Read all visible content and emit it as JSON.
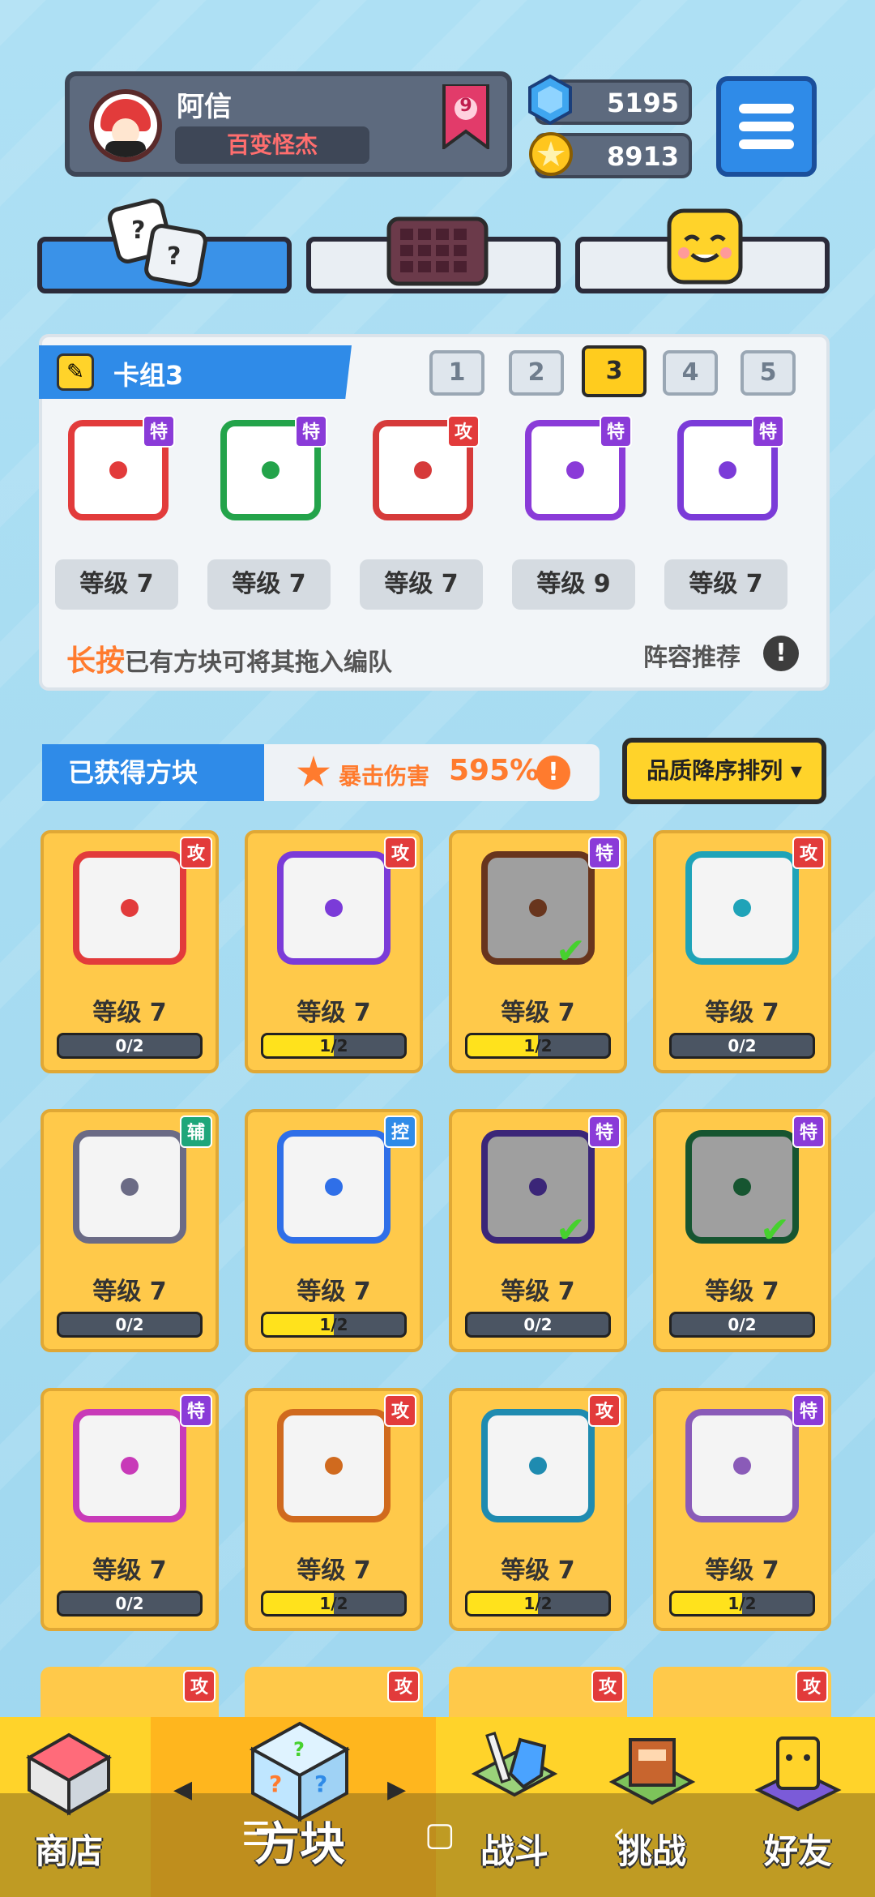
{
  "profile": {
    "name": "阿信",
    "title": "百变怪杰",
    "rank": "9"
  },
  "currency": {
    "gems": "5195",
    "coins": "8913"
  },
  "deck": {
    "title": "卡组3",
    "numbers": [
      "1",
      "2",
      "3",
      "4",
      "5"
    ],
    "selected": "3",
    "cards": [
      {
        "tag": "特",
        "level": "等级 7",
        "color": "#e23b3b"
      },
      {
        "tag": "特",
        "level": "等级 7",
        "color": "#23a34a"
      },
      {
        "tag": "攻",
        "level": "等级 7",
        "color": "#d63a3a"
      },
      {
        "tag": "特",
        "level": "等级 9",
        "color": "#8a3bd8"
      },
      {
        "tag": "特",
        "level": "等级 7",
        "color": "#7b3bd8"
      }
    ],
    "hint_highlight": "长按",
    "hint_rest": "已有方块可将其拖入编队",
    "recommend": "阵容推荐",
    "recommend_icon": "!"
  },
  "collection": {
    "title": "已获得方块",
    "crit_label": "暴击伤害",
    "crit_value": "595%",
    "crit_icon": "!",
    "sort_label": "品质降序排列 ▾"
  },
  "grid": [
    {
      "tag": "攻",
      "level": "等级 7",
      "progress": "0/2",
      "fill": 0,
      "color": "#e23b3b",
      "checked": false
    },
    {
      "tag": "攻",
      "level": "等级 7",
      "progress": "1/2",
      "fill": 0.5,
      "color": "#7b3bd8",
      "checked": false
    },
    {
      "tag": "特",
      "level": "等级 7",
      "progress": "1/2",
      "fill": 0.5,
      "color": "#a0522d",
      "checked": true
    },
    {
      "tag": "攻",
      "level": "等级 7",
      "progress": "0/2",
      "fill": 0,
      "color": "#1fa3b8",
      "checked": false
    },
    {
      "tag": "辅",
      "level": "等级 7",
      "progress": "0/2",
      "fill": 0,
      "color": "#6b6b85",
      "checked": false
    },
    {
      "tag": "控",
      "level": "等级 7",
      "progress": "1/2",
      "fill": 0.5,
      "color": "#2f6fe8",
      "checked": false
    },
    {
      "tag": "特",
      "level": "等级 7",
      "progress": "0/2",
      "fill": 0,
      "color": "#5b3bb8",
      "checked": true
    },
    {
      "tag": "特",
      "level": "等级 7",
      "progress": "0/2",
      "fill": 0,
      "color": "#23834a",
      "checked": true
    },
    {
      "tag": "特",
      "level": "等级 7",
      "progress": "0/2",
      "fill": 0,
      "color": "#c83ab8",
      "checked": false
    },
    {
      "tag": "攻",
      "level": "等级 7",
      "progress": "1/2",
      "fill": 0.5,
      "color": "#d06a1e",
      "checked": false
    },
    {
      "tag": "攻",
      "level": "等级 7",
      "progress": "1/2",
      "fill": 0.5,
      "color": "#1f8bb0",
      "checked": false
    },
    {
      "tag": "特",
      "level": "等级 7",
      "progress": "1/2",
      "fill": 0.5,
      "color": "#8a5bb8",
      "checked": false
    }
  ],
  "partial_row_tags": [
    "攻",
    "攻",
    "攻",
    "攻"
  ],
  "nav": {
    "shop": "商店",
    "blocks": "方块",
    "battle": "战斗",
    "challenge": "挑战",
    "friends": "好友"
  }
}
